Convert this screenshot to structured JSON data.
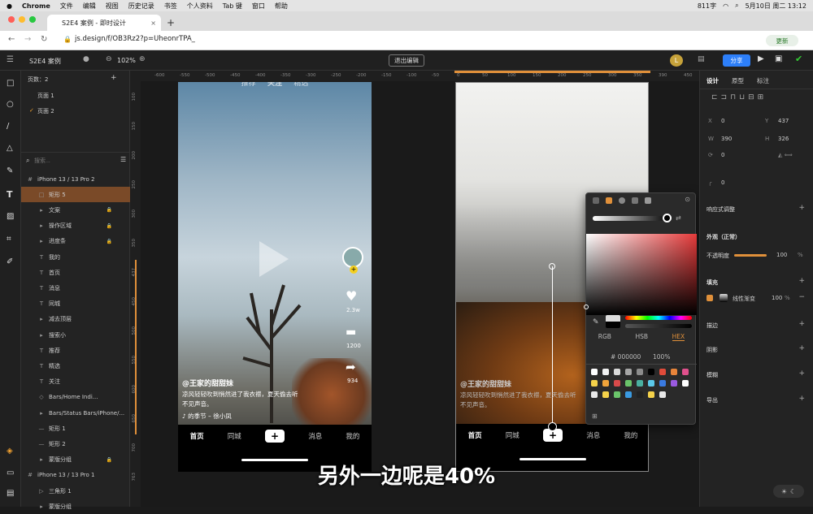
{
  "menubar": {
    "app": "Chrome",
    "items": [
      "文件",
      "编辑",
      "视图",
      "历史记录",
      "书签",
      "个人资料",
      "Tab 键",
      "窗口",
      "帮助"
    ],
    "speed": "811字",
    "date": "5月10日 周二 13:12"
  },
  "browser": {
    "tab_title": "S2E4 案例 - 即时设计",
    "url": "js.design/f/OB3Rz2?p=UheonrTPA_",
    "update_label": "更新"
  },
  "editor": {
    "file_name": "S2E4 案例",
    "zoom": "102%",
    "exit_label": "退出编辑",
    "share_label": "分享",
    "avatar": "L"
  },
  "layers": {
    "pages_label": "页数：2",
    "pages": [
      "页面 1",
      "页面 2"
    ],
    "search_placeholder": "搜索...",
    "items": [
      {
        "label": "iPhone 13 / 13 Pro 2",
        "icon": "#",
        "indent": 0
      },
      {
        "label": "矩形 5",
        "icon": "□",
        "indent": 1,
        "selected": true
      },
      {
        "label": "文案",
        "icon": "▸",
        "indent": 1,
        "locked": true
      },
      {
        "label": "操作区域",
        "icon": "▸",
        "indent": 1,
        "locked": true
      },
      {
        "label": "进度条",
        "icon": "▸",
        "indent": 1,
        "locked": true
      },
      {
        "label": "我的",
        "icon": "T",
        "indent": 1
      },
      {
        "label": "首页",
        "icon": "T",
        "indent": 1
      },
      {
        "label": "消息",
        "icon": "T",
        "indent": 1
      },
      {
        "label": "同城",
        "icon": "T",
        "indent": 1
      },
      {
        "label": "减去顶层",
        "icon": "▸",
        "indent": 1
      },
      {
        "label": "搜索小",
        "icon": "▸",
        "indent": 1
      },
      {
        "label": "推荐",
        "icon": "T",
        "indent": 1
      },
      {
        "label": "精选",
        "icon": "T",
        "indent": 1
      },
      {
        "label": "关注",
        "icon": "T",
        "indent": 1
      },
      {
        "label": "Bars/Home Indi...",
        "icon": "◇",
        "indent": 1
      },
      {
        "label": "Bars/Status Bars/iPhone/...",
        "icon": "▸",
        "indent": 1
      },
      {
        "label": "矩形 1",
        "icon": "—",
        "indent": 1
      },
      {
        "label": "矩形 2",
        "icon": "—",
        "indent": 1
      },
      {
        "label": "蒙版分组",
        "icon": "▸",
        "indent": 1,
        "locked": true
      },
      {
        "label": "iPhone 13 / 13 Pro 1",
        "icon": "#",
        "indent": 0
      },
      {
        "label": "三角形 1",
        "icon": "▷",
        "indent": 1
      },
      {
        "label": "蒙版分组",
        "icon": "▸",
        "indent": 1
      }
    ]
  },
  "rulers": {
    "h": [
      "-600",
      "-550",
      "-500",
      "-450",
      "-400",
      "-350",
      "-300",
      "-250",
      "-200",
      "-150",
      "-100",
      "-50",
      "0",
      "50",
      "100",
      "150",
      "200",
      "250",
      "300",
      "350",
      "390",
      "450"
    ],
    "v": [
      "100",
      "150",
      "200",
      "250",
      "300",
      "350",
      "437",
      "450",
      "500",
      "550",
      "600",
      "650",
      "700",
      "763"
    ]
  },
  "phone1": {
    "tabs": [
      "推荐",
      "关注",
      "精选"
    ],
    "likes": "2.3w",
    "comments": "1200",
    "shares": "934",
    "author": "@王家的甜甜妹",
    "caption1": "凉风轻轻吹到悄然进了我衣襟，夏天偷去听",
    "caption2": "不见声音。",
    "music": "的季节 – 徐小凤"
  },
  "phone2": {
    "author": "@王家的甜甜妹",
    "caption1": "凉风轻轻吹到悄然进了我衣襟，夏天偷去听",
    "caption2": "不见声音。"
  },
  "nav": {
    "items": [
      "首页",
      "同城",
      "+",
      "消息",
      "我的"
    ]
  },
  "colorpicker": {
    "modes": [
      "RGB",
      "HSB",
      "HEX"
    ],
    "active_mode": "HEX",
    "hex": "000000",
    "opacity": "100",
    "pct": "%",
    "swatches": [
      "#ffffff",
      "#f2f2f2",
      "#d9d9d9",
      "#a6a6a6",
      "#8c8c8c",
      "#000000",
      "#e04b3a",
      "#e8843a",
      "#e0508c",
      "#f5d24a",
      "#f0a43a",
      "#d84a4a",
      "#6ac46a",
      "#4ab0a0",
      "#5bc8e8",
      "#3a7ae0",
      "#9a5ae0",
      "#ffffff",
      "#e8e8e8",
      "#f5d24a",
      "#6ac46a",
      "#3a9ae0",
      "#222222",
      "#f5d24a",
      "#e8e8e8"
    ]
  },
  "rpanel": {
    "tabs": [
      "设计",
      "原型",
      "标注"
    ],
    "x": "0",
    "y": "437",
    "w": "390",
    "h": "326",
    "rot": "0",
    "radius": "0",
    "responsive": "响应式调整",
    "appearance": "外观（正常）",
    "opacity_label": "不透明度",
    "opacity": "100",
    "fill_title": "填充",
    "fill_type": "线性渐变",
    "fill_opacity": "100",
    "stroke": "描边",
    "shadow": "阴影",
    "blur": "模糊",
    "export": "导出"
  },
  "subtitle": "另外一边呢是40%"
}
